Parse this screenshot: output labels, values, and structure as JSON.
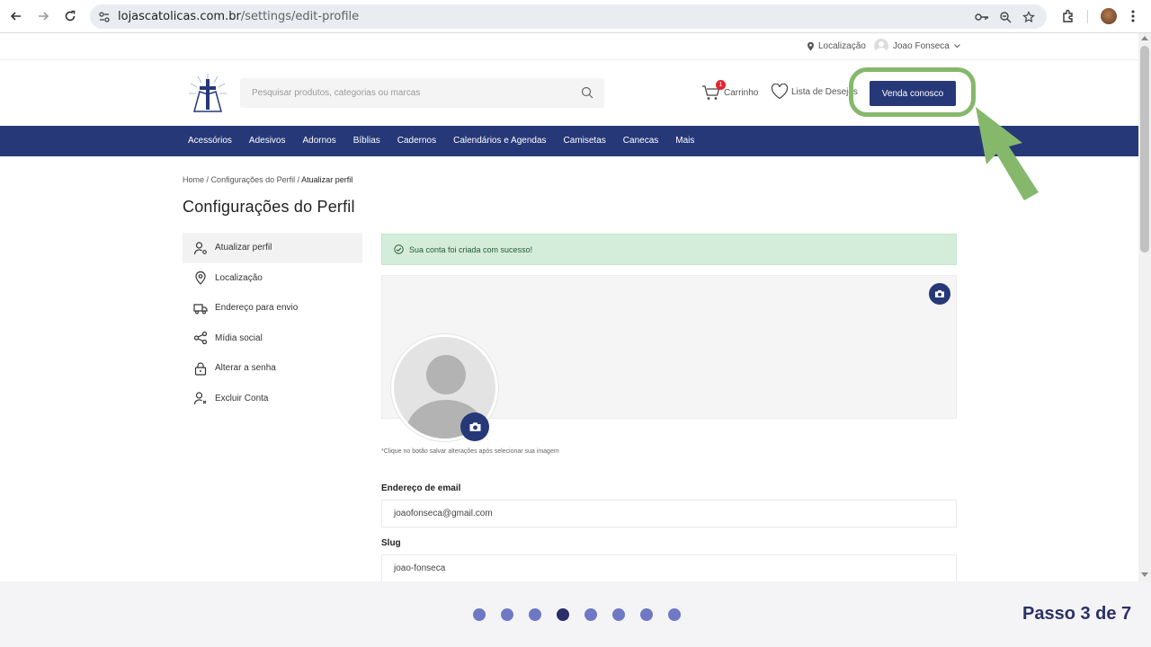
{
  "browser": {
    "url_host": "lojascatolicas.com.br",
    "url_path": "/settings/edit-profile"
  },
  "topbar": {
    "location_label": "Localização",
    "user_name": "Joao Fonseca"
  },
  "header": {
    "search_placeholder": "Pesquisar produtos, categorias ou marcas",
    "cart_label": "Carrinho",
    "cart_count": "1",
    "wishlist_label": "Lista de Desejos",
    "sell_button": "Venda conosco"
  },
  "categories": [
    "Acessórios",
    "Adesivos",
    "Adornos",
    "Bíblias",
    "Cadernos",
    "Calendários e Agendas",
    "Camisetas",
    "Canecas",
    "Mais"
  ],
  "breadcrumb": {
    "home": "Home",
    "sep": "/",
    "section": "Configurações do Perfil",
    "current": "Atualizar perfil"
  },
  "page_title": "Configurações do Perfil",
  "sidebar": {
    "items": [
      {
        "label": "Atualizar perfil",
        "icon": "user-gear-icon"
      },
      {
        "label": "Localização",
        "icon": "location-pin-icon"
      },
      {
        "label": "Endereço para envio",
        "icon": "truck-icon"
      },
      {
        "label": "Mídia social",
        "icon": "share-icon"
      },
      {
        "label": "Alterar a senha",
        "icon": "lock-icon"
      },
      {
        "label": "Excluir Conta",
        "icon": "user-remove-icon"
      }
    ]
  },
  "alert_text": "Sua conta foi criada com sucesso!",
  "image_hint": "*Clique no botão salvar alterações após selecionar sua imagem",
  "form": {
    "email_label": "Endereço de email",
    "email_value": "joaofonseca@gmail.com",
    "slug_label": "Slug",
    "slug_value": "joao-fonseca"
  },
  "progress": {
    "steps": 8,
    "current": 4,
    "label": "Passo 3 de 7"
  },
  "colors": {
    "brand": "#263878",
    "highlight": "#86b86c",
    "alert_bg": "#d4edda"
  }
}
